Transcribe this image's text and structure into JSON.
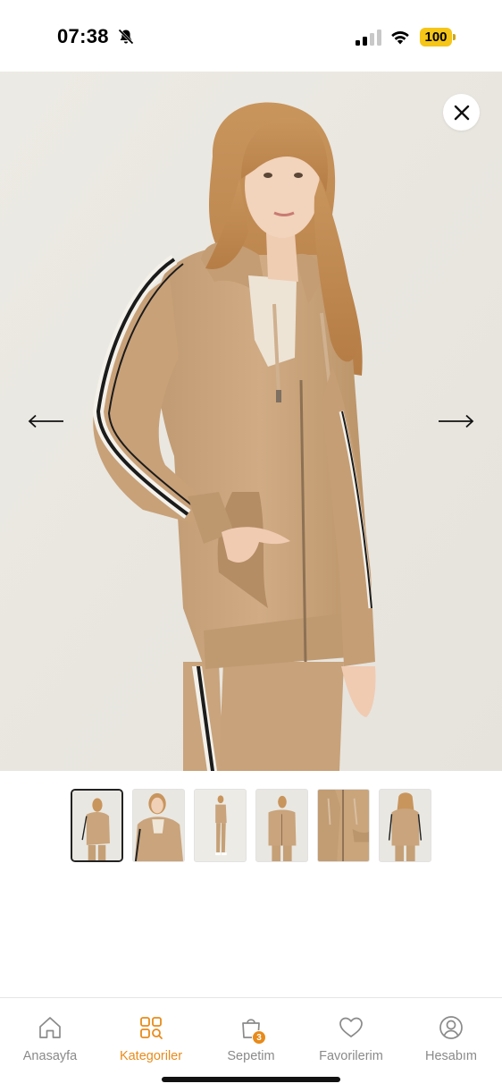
{
  "status_bar": {
    "time": "07:38",
    "battery": "100",
    "icons": [
      "bell-slash-icon",
      "signal-icon",
      "wifi-icon",
      "battery-icon"
    ]
  },
  "viewer": {
    "close_icon": "close-icon",
    "prev_icon": "arrow-left-icon",
    "next_icon": "arrow-right-icon",
    "active_index": 0,
    "thumbnail_count": 6
  },
  "tab_bar": {
    "active_color": "#e88b1a",
    "inactive_color": "#8a8a8a",
    "items": [
      {
        "label": "Anasayfa",
        "icon": "home-icon"
      },
      {
        "label": "Kategoriler",
        "icon": "categories-icon"
      },
      {
        "label": "Sepetim",
        "icon": "cart-icon",
        "badge": "3"
      },
      {
        "label": "Favorilerim",
        "icon": "heart-icon"
      },
      {
        "label": "Hesabım",
        "icon": "account-icon"
      }
    ]
  }
}
